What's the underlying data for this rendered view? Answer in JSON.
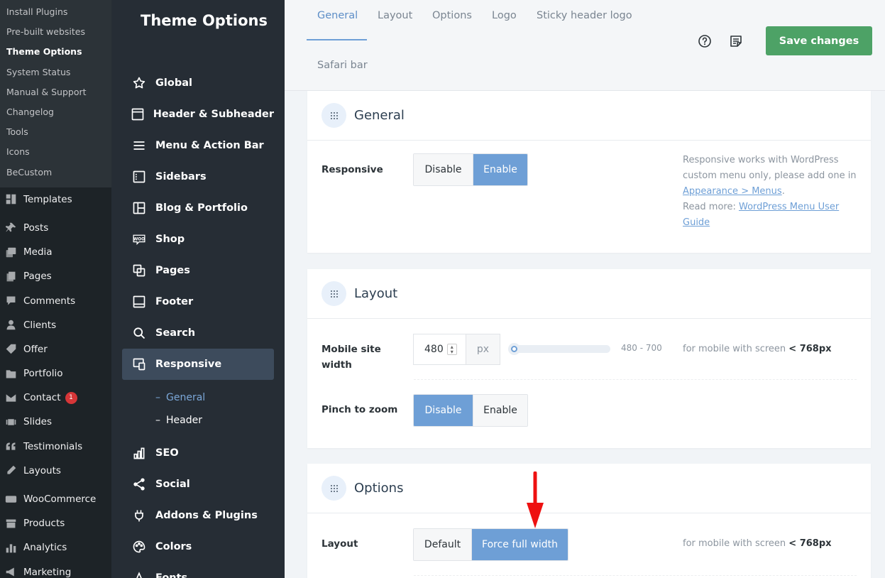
{
  "wp_submenu": [
    {
      "label": "Install Plugins",
      "current": false
    },
    {
      "label": "Pre-built websites",
      "current": false
    },
    {
      "label": "Theme Options",
      "current": true
    },
    {
      "label": "System Status",
      "current": false
    },
    {
      "label": "Manual & Support",
      "current": false
    },
    {
      "label": "Changelog",
      "current": false
    },
    {
      "label": "Tools",
      "current": false
    },
    {
      "label": "Icons",
      "current": false
    },
    {
      "label": "BeCustom",
      "current": false
    }
  ],
  "wp_menu": [
    {
      "label": "Templates",
      "icon": "templates-icon",
      "sep_before": false
    },
    {
      "label": "Posts",
      "icon": "pin-icon",
      "sep_before": true
    },
    {
      "label": "Media",
      "icon": "media-icon",
      "sep_before": false
    },
    {
      "label": "Pages",
      "icon": "pages-icon",
      "sep_before": false
    },
    {
      "label": "Comments",
      "icon": "comments-icon",
      "sep_before": false
    },
    {
      "label": "Clients",
      "icon": "user-icon",
      "sep_before": false
    },
    {
      "label": "Offer",
      "icon": "tag-icon",
      "sep_before": false
    },
    {
      "label": "Portfolio",
      "icon": "folder-icon",
      "sep_before": false
    },
    {
      "label": "Contact",
      "icon": "mail-icon",
      "sep_before": false,
      "badge": "1"
    },
    {
      "label": "Slides",
      "icon": "slides-icon",
      "sep_before": false
    },
    {
      "label": "Testimonials",
      "icon": "quote-icon",
      "sep_before": false
    },
    {
      "label": "Layouts",
      "icon": "pencil-icon",
      "sep_before": false
    },
    {
      "label": "WooCommerce",
      "icon": "woo-icon",
      "sep_before": true
    },
    {
      "label": "Products",
      "icon": "archive-icon",
      "sep_before": false
    },
    {
      "label": "Analytics",
      "icon": "chart-icon",
      "sep_before": false
    },
    {
      "label": "Marketing",
      "icon": "megaphone-icon",
      "sep_before": false
    }
  ],
  "theme_options": {
    "title": "Theme Options",
    "menu": [
      {
        "label": "Global",
        "icon": "star-icon"
      },
      {
        "label": "Header & Subheader",
        "icon": "header-icon"
      },
      {
        "label": "Menu & Action Bar",
        "icon": "menu-icon"
      },
      {
        "label": "Sidebars",
        "icon": "sidebar-icon"
      },
      {
        "label": "Blog & Portfolio",
        "icon": "layout-icon"
      },
      {
        "label": "Shop",
        "icon": "woo-icon"
      },
      {
        "label": "Pages",
        "icon": "copy-icon"
      },
      {
        "label": "Footer",
        "icon": "footer-icon"
      },
      {
        "label": "Search",
        "icon": "search-icon"
      },
      {
        "label": "Responsive",
        "icon": "responsive-icon",
        "active": true
      },
      {
        "label": "SEO",
        "icon": "bars-icon"
      },
      {
        "label": "Social",
        "icon": "share-icon"
      },
      {
        "label": "Addons & Plugins",
        "icon": "plug-icon"
      },
      {
        "label": "Colors",
        "icon": "palette-icon"
      },
      {
        "label": "Fonts",
        "icon": "font-icon"
      }
    ],
    "responsive_sub": [
      {
        "label": "General",
        "active": true
      },
      {
        "label": "Header",
        "active": false
      }
    ]
  },
  "tabs": [
    {
      "label": "General",
      "active": true
    },
    {
      "label": "Layout",
      "active": false
    },
    {
      "label": "Options",
      "active": false
    },
    {
      "label": "Logo",
      "active": false
    },
    {
      "label": "Sticky header logo",
      "active": false
    },
    {
      "label": "Safari bar",
      "active": false
    }
  ],
  "save_label": "Save changes",
  "sections": {
    "general": {
      "title": "General",
      "responsive": {
        "label": "Responsive",
        "options": [
          "Disable",
          "Enable"
        ],
        "selected": "Enable",
        "desc1": "Responsive works with WordPress",
        "desc2": "custom menu only, please add one in",
        "desc_link1": "Appearance > Menus",
        "desc3": "Read more: ",
        "desc_link2a": "WordPress Menu User",
        "desc_link2b": "Guide",
        "period": "."
      }
    },
    "layout": {
      "title": "Layout",
      "mobile_width": {
        "label": "Mobile site width",
        "value": "480",
        "unit": "px",
        "range": "480 - 700",
        "slider_min": 480,
        "slider_max": 700,
        "slider_value": 480,
        "desc": "for mobile with screen ",
        "desc_bold": "< 768px"
      },
      "pinch": {
        "label": "Pinch to zoom",
        "options": [
          "Disable",
          "Enable"
        ],
        "selected": "Disable"
      }
    },
    "options": {
      "title": "Options",
      "layout": {
        "label": "Layout",
        "options": [
          "Default",
          "Force full width"
        ],
        "selected": "Force full width",
        "desc": "for mobile with screen ",
        "desc_bold": "< 768px"
      }
    }
  },
  "colors": {
    "accent": "#6e9fd6",
    "save": "#4da266",
    "annotation_arrow": "#ee1111"
  }
}
